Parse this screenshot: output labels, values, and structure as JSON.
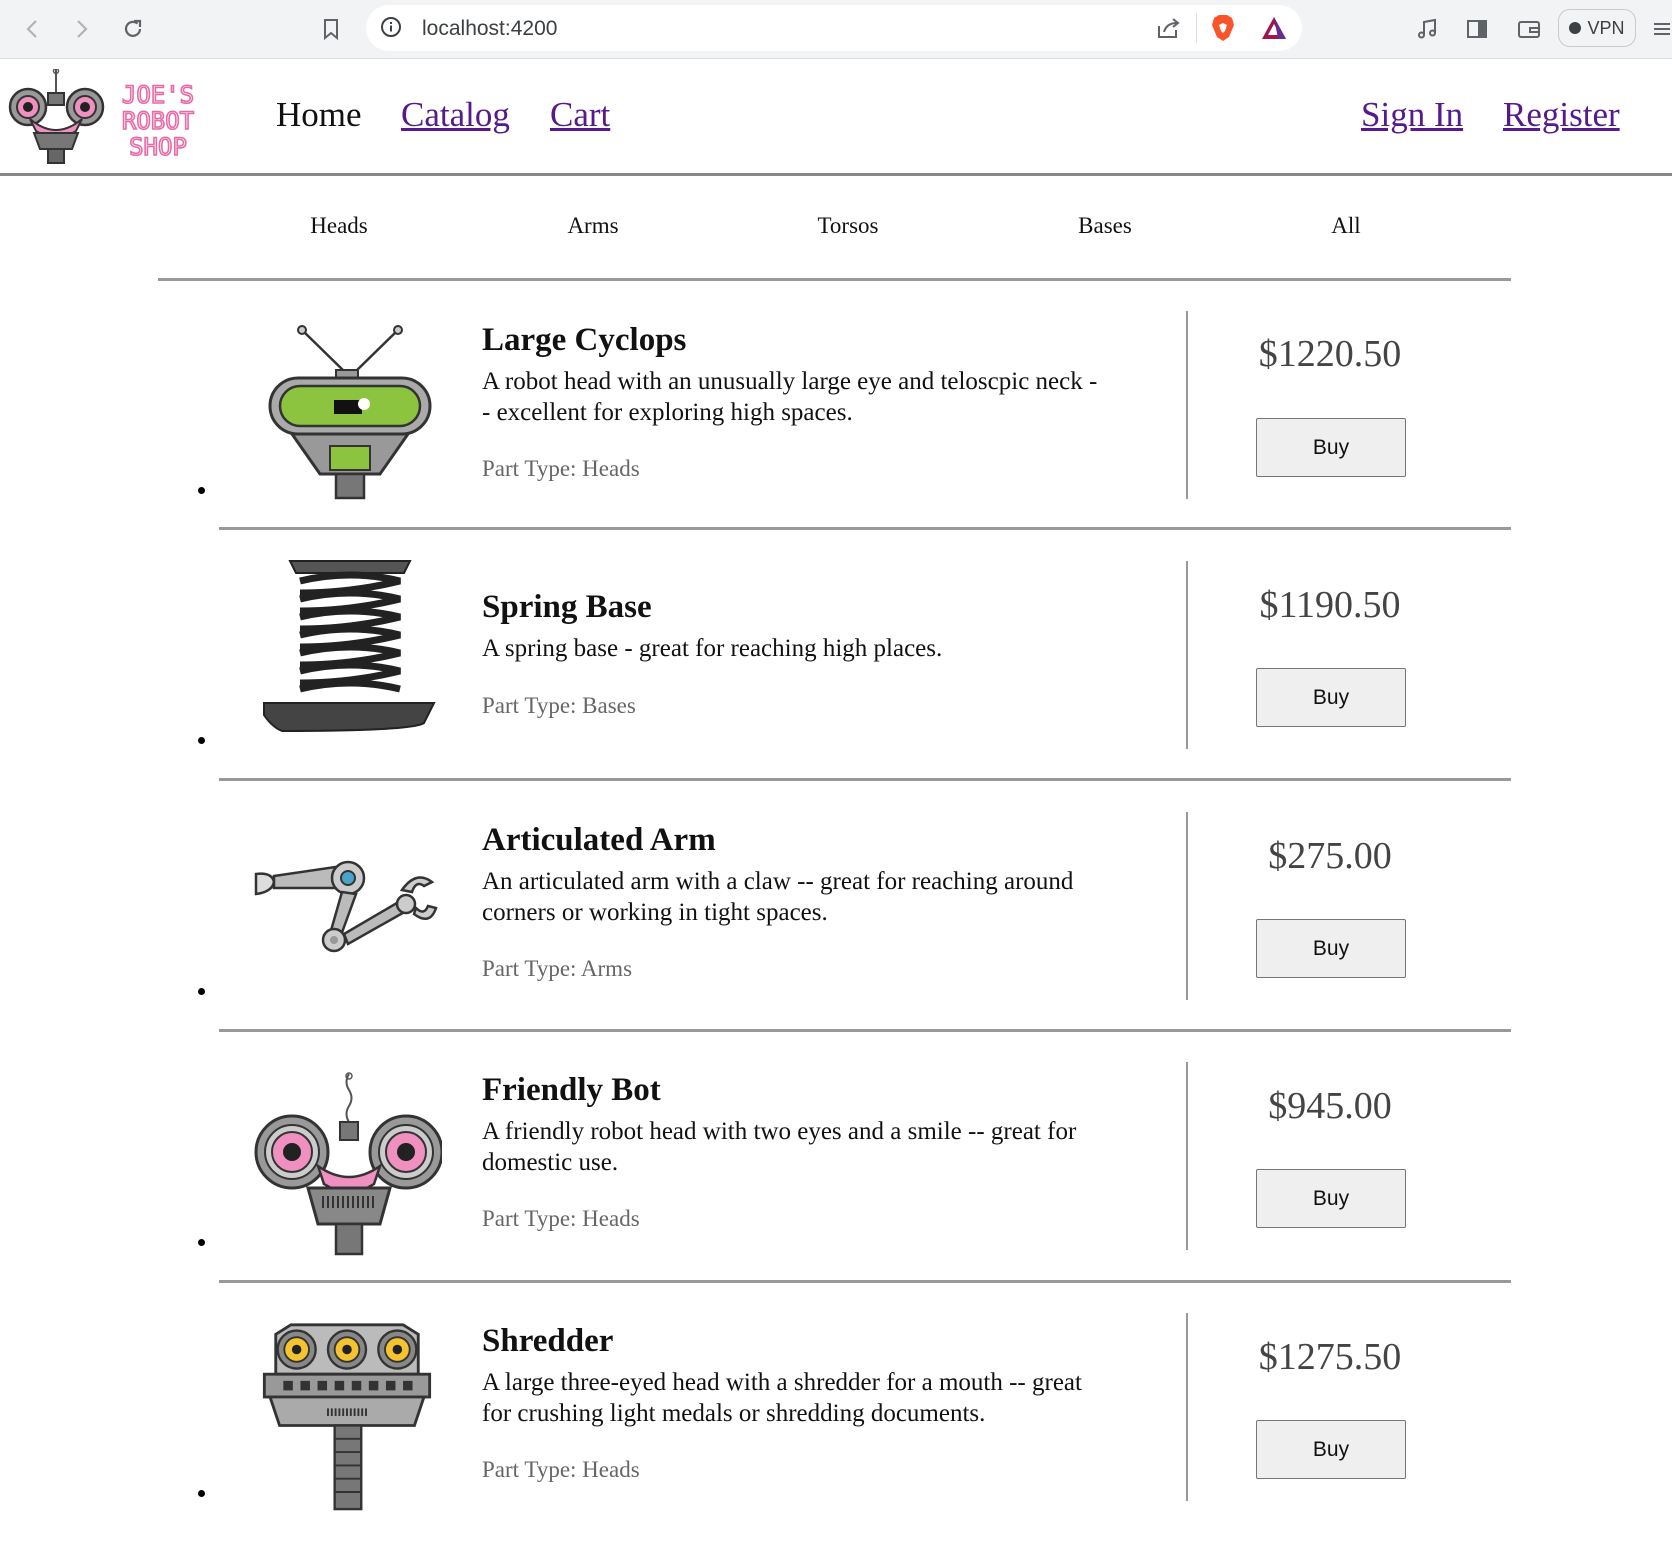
{
  "browser": {
    "url": "localhost:4200",
    "vpn_label": "VPN"
  },
  "site": {
    "logo_lines": [
      "JOE'S",
      "ROBOT",
      "SHOP"
    ],
    "nav": [
      {
        "label": "Home"
      },
      {
        "label": "Catalog"
      },
      {
        "label": "Cart"
      }
    ],
    "auth": [
      {
        "label": "Sign In"
      },
      {
        "label": "Register"
      }
    ]
  },
  "filters": [
    {
      "label": "Heads"
    },
    {
      "label": "Arms"
    },
    {
      "label": "Torsos"
    },
    {
      "label": "Bases"
    },
    {
      "label": "All"
    }
  ],
  "products": [
    {
      "name": "Large Cyclops",
      "description": "A robot head with an unusually large eye and teloscpic neck -- excellent for exploring high spaces.",
      "part_type": "Part Type: Heads",
      "price": "$1220.50",
      "buy_label": "Buy",
      "icon": "large-cyclops-robot-head-image"
    },
    {
      "name": "Spring Base",
      "description": "A spring base - great for reaching high places.",
      "part_type": "Part Type: Bases",
      "price": "$1190.50",
      "buy_label": "Buy",
      "icon": "spring-base-image"
    },
    {
      "name": "Articulated Arm",
      "description": "An articulated arm with a claw -- great for reaching around corners or working in tight spaces.",
      "part_type": "Part Type: Arms",
      "price": "$275.00",
      "buy_label": "Buy",
      "icon": "articulated-arm-image"
    },
    {
      "name": "Friendly Bot",
      "description": "A friendly robot head with two eyes and a smile -- great for domestic use.",
      "part_type": "Part Type: Heads",
      "price": "$945.00",
      "buy_label": "Buy",
      "icon": "friendly-bot-head-image"
    },
    {
      "name": "Shredder",
      "description": "A large three-eyed head with a shredder for a mouth -- great for crushing light medals or shredding documents.",
      "part_type": "Part Type: Heads",
      "price": "$1275.50",
      "buy_label": "Buy",
      "icon": "shredder-head-image"
    }
  ]
}
